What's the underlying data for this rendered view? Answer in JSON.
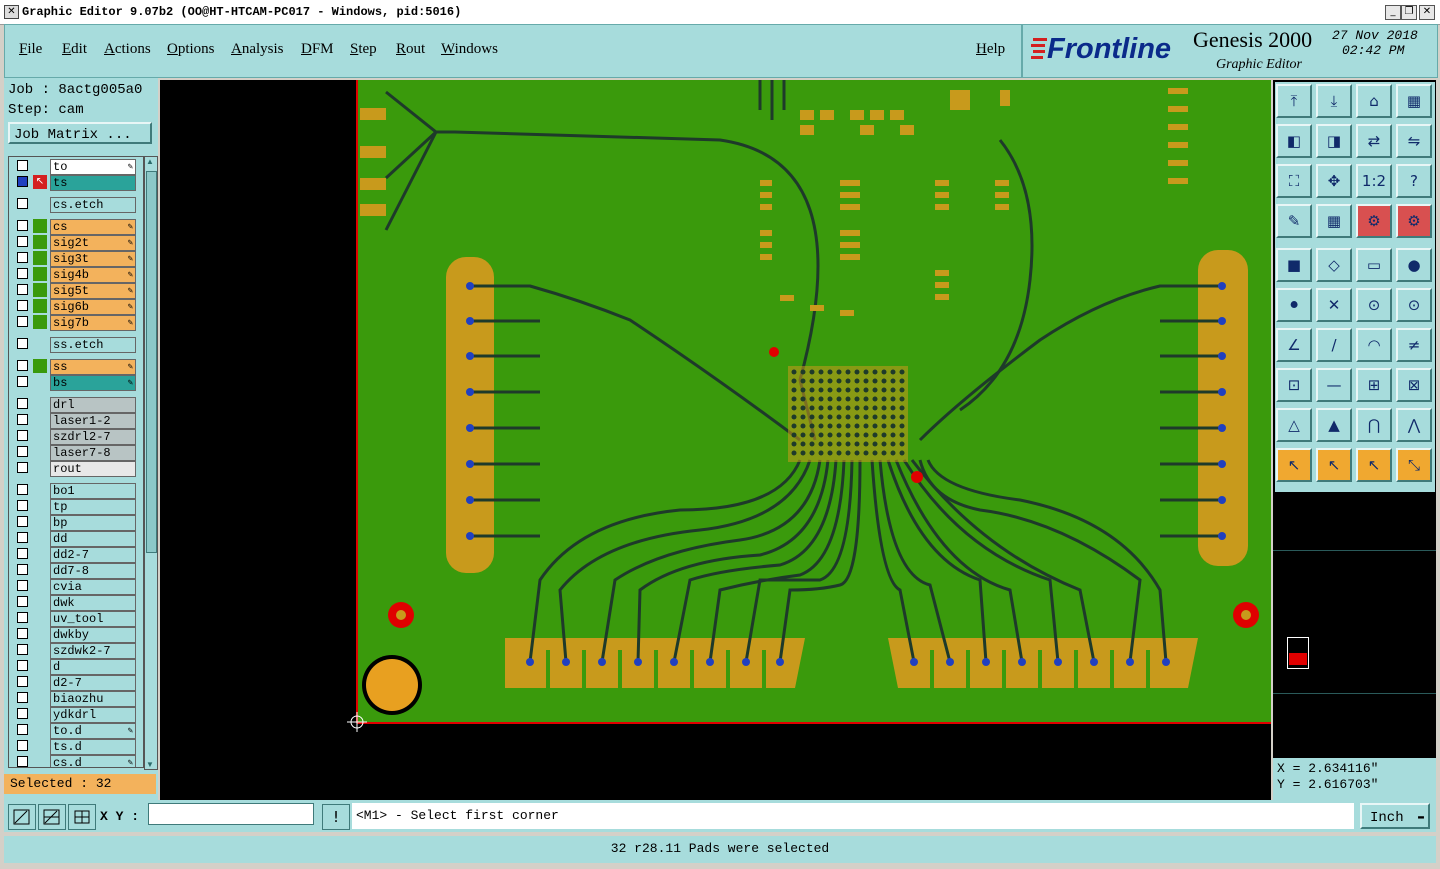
{
  "window": {
    "title": "Graphic Editor 9.07b2 (OO@HT-HTCAM-PC017 - Windows, pid:5016)"
  },
  "menu": {
    "items": [
      "File",
      "Edit",
      "Actions",
      "Options",
      "Analysis",
      "DFM",
      "Step",
      "Rout",
      "Windows"
    ],
    "help": "Help"
  },
  "brand": {
    "logo": "Frontline",
    "product": "Genesis 2000",
    "subtitle": "Graphic Editor",
    "date": "27 Nov 2018",
    "time": "02:42 PM"
  },
  "job": {
    "job_label": "Job : 8actg005a0",
    "step_label": "Step: cam",
    "matrix_button": "Job Matrix ..."
  },
  "layers": [
    {
      "name": "to",
      "color": "#ffffff",
      "edit": true
    },
    {
      "name": "ts",
      "color": "#2aa39a",
      "edit": false,
      "active": true
    },
    {
      "name": "cs.etch",
      "color": "#a7dcdc",
      "edit": false
    },
    {
      "name": "cs",
      "color": "#f3b25c",
      "edit": true
    },
    {
      "name": "sig2t",
      "color": "#f3b25c",
      "edit": true
    },
    {
      "name": "sig3t",
      "color": "#f3b25c",
      "edit": true
    },
    {
      "name": "sig4b",
      "color": "#f3b25c",
      "edit": true
    },
    {
      "name": "sig5t",
      "color": "#f3b25c",
      "edit": true
    },
    {
      "name": "sig6b",
      "color": "#f3b25c",
      "edit": true
    },
    {
      "name": "sig7b",
      "color": "#f3b25c",
      "edit": true
    },
    {
      "name": "ss.etch",
      "color": "#a7dcdc",
      "edit": false
    },
    {
      "name": "ss",
      "color": "#f3b25c",
      "edit": true
    },
    {
      "name": "bs",
      "color": "#2aa39a",
      "edit": true
    },
    {
      "name": "drl",
      "color": "#b8c4c4",
      "edit": false
    },
    {
      "name": "laser1-2",
      "color": "#b8c4c4",
      "edit": false
    },
    {
      "name": "szdrl2-7",
      "color": "#b8c4c4",
      "edit": false
    },
    {
      "name": "laser7-8",
      "color": "#b8c4c4",
      "edit": false
    },
    {
      "name": "rout",
      "color": "#e8e8e8",
      "edit": false
    },
    {
      "name": "bo1",
      "color": "#a7dcdc",
      "edit": false
    },
    {
      "name": "tp",
      "color": "#a7dcdc",
      "edit": false
    },
    {
      "name": "bp",
      "color": "#a7dcdc",
      "edit": false
    },
    {
      "name": "dd",
      "color": "#a7dcdc",
      "edit": false
    },
    {
      "name": "dd2-7",
      "color": "#a7dcdc",
      "edit": false
    },
    {
      "name": "dd7-8",
      "color": "#a7dcdc",
      "edit": false
    },
    {
      "name": "cvia",
      "color": "#a7dcdc",
      "edit": false
    },
    {
      "name": "dwk",
      "color": "#a7dcdc",
      "edit": false
    },
    {
      "name": "uv_tool",
      "color": "#a7dcdc",
      "edit": false
    },
    {
      "name": "dwkby",
      "color": "#a7dcdc",
      "edit": false
    },
    {
      "name": "szdwk2-7",
      "color": "#a7dcdc",
      "edit": false
    },
    {
      "name": "d",
      "color": "#a7dcdc",
      "edit": false
    },
    {
      "name": "d2-7",
      "color": "#a7dcdc",
      "edit": false
    },
    {
      "name": "biaozhu",
      "color": "#a7dcdc",
      "edit": false
    },
    {
      "name": "ydkdrl",
      "color": "#a7dcdc",
      "edit": false
    },
    {
      "name": "to.d",
      "color": "#a7dcdc",
      "edit": true
    },
    {
      "name": "ts.d",
      "color": "#a7dcdc",
      "edit": false
    },
    {
      "name": "cs.d",
      "color": "#a7dcdc",
      "edit": true
    }
  ],
  "selection": {
    "selected_label": "Selected : 32"
  },
  "coords": {
    "x_label": "X = 2.634116\"",
    "y_label": "Y = 2.616703\""
  },
  "command": {
    "xy_label": "X Y :",
    "xy_value": "",
    "prompt": "<M1> - Select first corner",
    "units": "Inch"
  },
  "status": {
    "message": "32 r28.11 Pads were selected"
  },
  "colors": {
    "board": "#3a9a0c",
    "copper": "#c89a1c",
    "trace": "#1e3a2a",
    "panel": "#a7dcdc",
    "outline": "#e00000",
    "highlight": "#f3b25c"
  }
}
